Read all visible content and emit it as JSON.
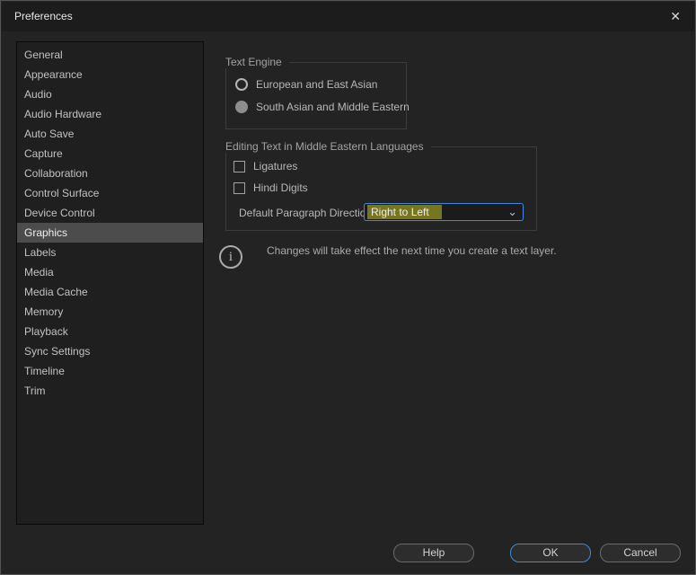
{
  "window": {
    "title": "Preferences",
    "close_glyph": "✕"
  },
  "sidebar": {
    "items": [
      {
        "label": "General",
        "selected": false
      },
      {
        "label": "Appearance",
        "selected": false
      },
      {
        "label": "Audio",
        "selected": false
      },
      {
        "label": "Audio Hardware",
        "selected": false
      },
      {
        "label": "Auto Save",
        "selected": false
      },
      {
        "label": "Capture",
        "selected": false
      },
      {
        "label": "Collaboration",
        "selected": false
      },
      {
        "label": "Control Surface",
        "selected": false
      },
      {
        "label": "Device Control",
        "selected": false
      },
      {
        "label": "Graphics",
        "selected": true
      },
      {
        "label": "Labels",
        "selected": false
      },
      {
        "label": "Media",
        "selected": false
      },
      {
        "label": "Media Cache",
        "selected": false
      },
      {
        "label": "Memory",
        "selected": false
      },
      {
        "label": "Playback",
        "selected": false
      },
      {
        "label": "Sync Settings",
        "selected": false
      },
      {
        "label": "Timeline",
        "selected": false
      },
      {
        "label": "Trim",
        "selected": false
      }
    ]
  },
  "text_engine": {
    "group_label": "Text Engine",
    "options": [
      {
        "label": "European and East Asian",
        "selected": false
      },
      {
        "label": "South Asian and Middle Eastern",
        "selected": true
      }
    ]
  },
  "middle_eastern": {
    "group_label": "Editing Text in Middle Eastern Languages",
    "checkboxes": [
      {
        "label": "Ligatures",
        "checked": false
      },
      {
        "label": "Hindi Digits",
        "checked": false
      }
    ],
    "paragraph_direction": {
      "label": "Default Paragraph Direction:",
      "value": "Right to Left",
      "chevron_glyph": "⌄"
    }
  },
  "note": {
    "icon_glyph": "i",
    "text": "Changes will take effect the next time you create a text layer."
  },
  "footer": {
    "help_label": "Help",
    "ok_label": "OK",
    "cancel_label": "Cancel"
  },
  "colors": {
    "dialog_bg": "#232323",
    "titlebar_bg": "#1c1c1c",
    "sidebar_bg": "#1f1f1f",
    "selected_row_bg": "#4c4c4c",
    "accent_blue": "#3f8ae0",
    "highlight_olive": "#75761f",
    "text_gray": "#b8b8b8"
  }
}
